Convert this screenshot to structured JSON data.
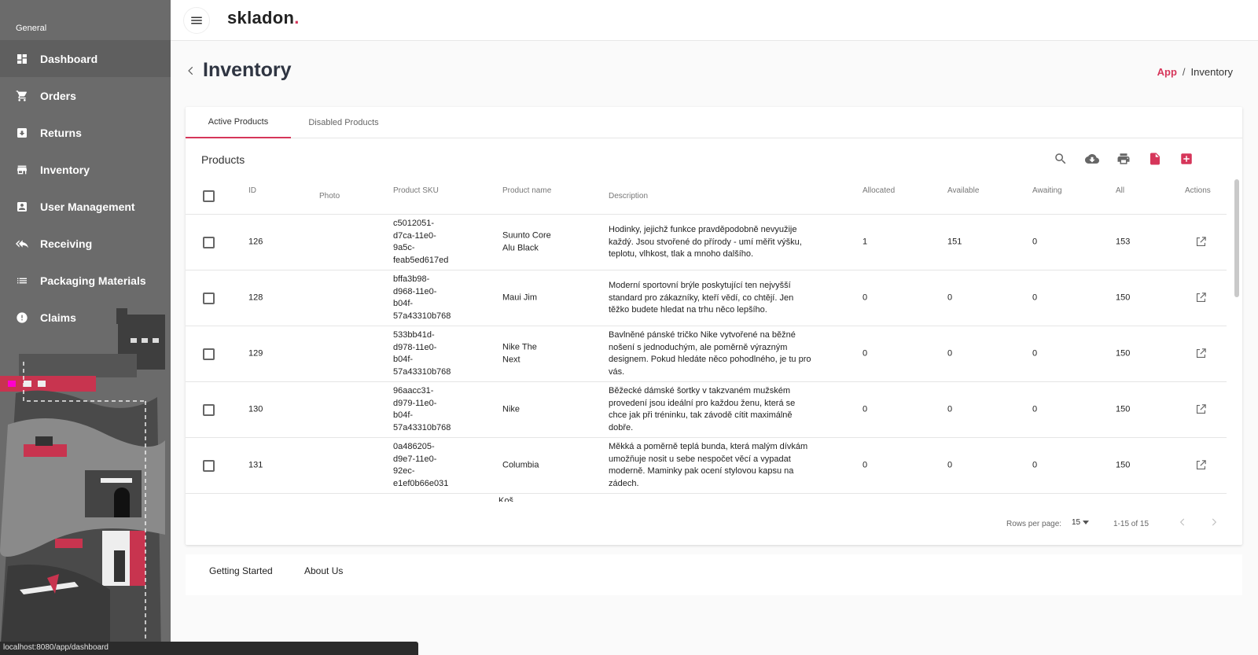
{
  "sidebar": {
    "section_label": "General",
    "items": [
      {
        "label": "Dashboard",
        "icon": "dashboard-icon"
      },
      {
        "label": "Orders",
        "icon": "cart-icon"
      },
      {
        "label": "Returns",
        "icon": "return-box-icon"
      },
      {
        "label": "Inventory",
        "icon": "inventory-icon"
      },
      {
        "label": "User Management",
        "icon": "user-card-icon"
      },
      {
        "label": "Receiving",
        "icon": "reply-all-icon"
      },
      {
        "label": "Packaging Materials",
        "icon": "list-icon"
      },
      {
        "label": "Claims",
        "icon": "alert-circle-icon"
      }
    ]
  },
  "topbar": {
    "logo_text": "skladon",
    "logo_dot": "."
  },
  "header": {
    "title": "Inventory",
    "breadcrumb": {
      "root": "App",
      "separator": "/",
      "current": "Inventory"
    }
  },
  "tabs": [
    {
      "label": "Active Products",
      "active": true
    },
    {
      "label": "Disabled Products",
      "active": false
    }
  ],
  "products": {
    "title": "Products",
    "columns": {
      "id": "ID",
      "photo": "Photo",
      "sku": "Product SKU",
      "name": "Product name",
      "description": "Description",
      "allocated": "Allocated",
      "available": "Available",
      "awaiting": "Awaiting",
      "all": "All",
      "actions": "Actions"
    },
    "rows": [
      {
        "id": "126",
        "sku": "c5012051-\nd7ca-11e0-\n9a5c-\nfeab5ed617ed",
        "name": "Suunto Core\nAlu Black",
        "description": "Hodinky, jejichž funkce pravděpodobně nevyužije\nkaždý. Jsou stvořené do přírody - umí měřit výšku,\nteplotu, vlhkost, tlak a mnoho dalšího.",
        "allocated": "1",
        "available": "151",
        "awaiting": "0",
        "all": "153"
      },
      {
        "id": "128",
        "sku": "bffa3b98-\nd968-11e0-\nb04f-\n57a43310b768",
        "name": "Maui Jim",
        "description": "Moderní sportovní brýle poskytující ten nejvyšší\nstandard pro zákazníky, kteří vědí, co chtějí. Jen\ntěžko budete hledat na trhu něco lepšího.",
        "allocated": "0",
        "available": "0",
        "awaiting": "0",
        "all": "150"
      },
      {
        "id": "129",
        "sku": "533bb41d-\nd978-11e0-\nb04f-\n57a43310b768",
        "name": "Nike The\nNext",
        "description": "Bavlněné pánské tričko Nike vytvořené na běžné\nnošení s jednoduchým, ale poměrně výrazným\ndesignem. Pokud hledáte něco pohodlného, je tu pro\nvás.",
        "allocated": "0",
        "available": "0",
        "awaiting": "0",
        "all": "150"
      },
      {
        "id": "130",
        "sku": "96aacc31-\nd979-11e0-\nb04f-\n57a43310b768",
        "name": "Nike",
        "description": "Běžecké dámské šortky v takzvaném mužském\nprovedení jsou ideální pro každou ženu, která se\nchce jak při tréninku, tak závodě cítit maximálně\ndobře.",
        "allocated": "0",
        "available": "0",
        "awaiting": "0",
        "all": "150"
      },
      {
        "id": "131",
        "sku": "0a486205-\nd9e7-11e0-\n92ec-\ne1ef0b66e031",
        "name": "Columbia",
        "description": "Měkká a poměrně teplá bunda, která malým dívkám\numožňuje nosit u sebe nespočet věcí a vypadat\nmoderně. Maminky pak ocení stylovou kapsu na\nzádech.",
        "allocated": "0",
        "available": "0",
        "awaiting": "0",
        "all": "150"
      }
    ],
    "next_row_peek": "Koš",
    "toolbar_icons": [
      "search-icon",
      "cloud-download-icon",
      "print-icon",
      "pdf-file-icon",
      "add-box-icon"
    ],
    "pagination": {
      "rows_per_page_label": "Rows per page:",
      "rows_per_page_value": "15",
      "range": "1-15 of 15"
    }
  },
  "footer": {
    "links": [
      "Getting Started",
      "About Us"
    ]
  },
  "statusbar": {
    "url": "localhost:8080/app/dashboard"
  },
  "colors": {
    "accent": "#d6365a",
    "sidebar_bg": "#6b6b6b",
    "text_dark": "#2f3542"
  }
}
